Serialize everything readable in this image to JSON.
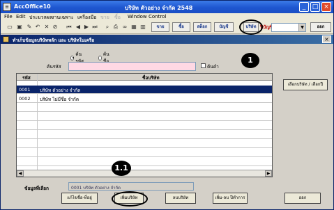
{
  "window": {
    "app_title": "AccOffice10",
    "center_title": "บริษัท ตัวอย่าง จำกัด  2548"
  },
  "menu": [
    "File",
    "Edit",
    "ประมวลผล",
    "งานเฉพาะ",
    "เครื่องมือ",
    "ขาย",
    "ซื้อ",
    "Window",
    "Control"
  ],
  "menu_disabled": [
    false,
    false,
    false,
    false,
    false,
    true,
    true,
    false,
    false
  ],
  "toolbar": {
    "buttons": [
      "ขาย",
      "ซื้อ",
      "สต็อก",
      "บัญชี"
    ],
    "company_button": "บริษัท",
    "period_label": "ปีบัญชี",
    "exit_label": "ออก"
  },
  "child": {
    "title": "ทำเก็บข้อมูลบริษัทหลัก และ บริษัทในเครือ",
    "search_by_code": "ค้นรหัส",
    "search_by_name": "ค้น ชื่อ",
    "search_label": "ค้นรหัส",
    "search_value": "",
    "wildcard_label": "ค้นคำ",
    "columns": [
      "รหัส",
      "ชื่อบริษัท"
    ],
    "rows": [
      {
        "code": "0001",
        "name": "บริษัท ตัวอย่าง จำกัด",
        "selected": true
      },
      {
        "code": "0002",
        "name": "บริษัท ไม่มีชื่อ จำกัด",
        "selected": false
      }
    ],
    "select_company_button": "เลือกบริษัท / เลือกปี",
    "selected_label": "ข้อมูลที่เลือก",
    "selected_value": "0001 บริษัท ตัวอย่าง จำกัด",
    "edit_button": "แก้ไขชื่อ-ที่อยู่",
    "add_button": "เพิ่มบริษัท",
    "delete_button": "ลบบริษัท",
    "addyear_button": "เพิ่ม-ลบ ปีทำการ",
    "close_button": "ออก"
  },
  "callouts": {
    "one": "1",
    "one_one": "1.1"
  }
}
